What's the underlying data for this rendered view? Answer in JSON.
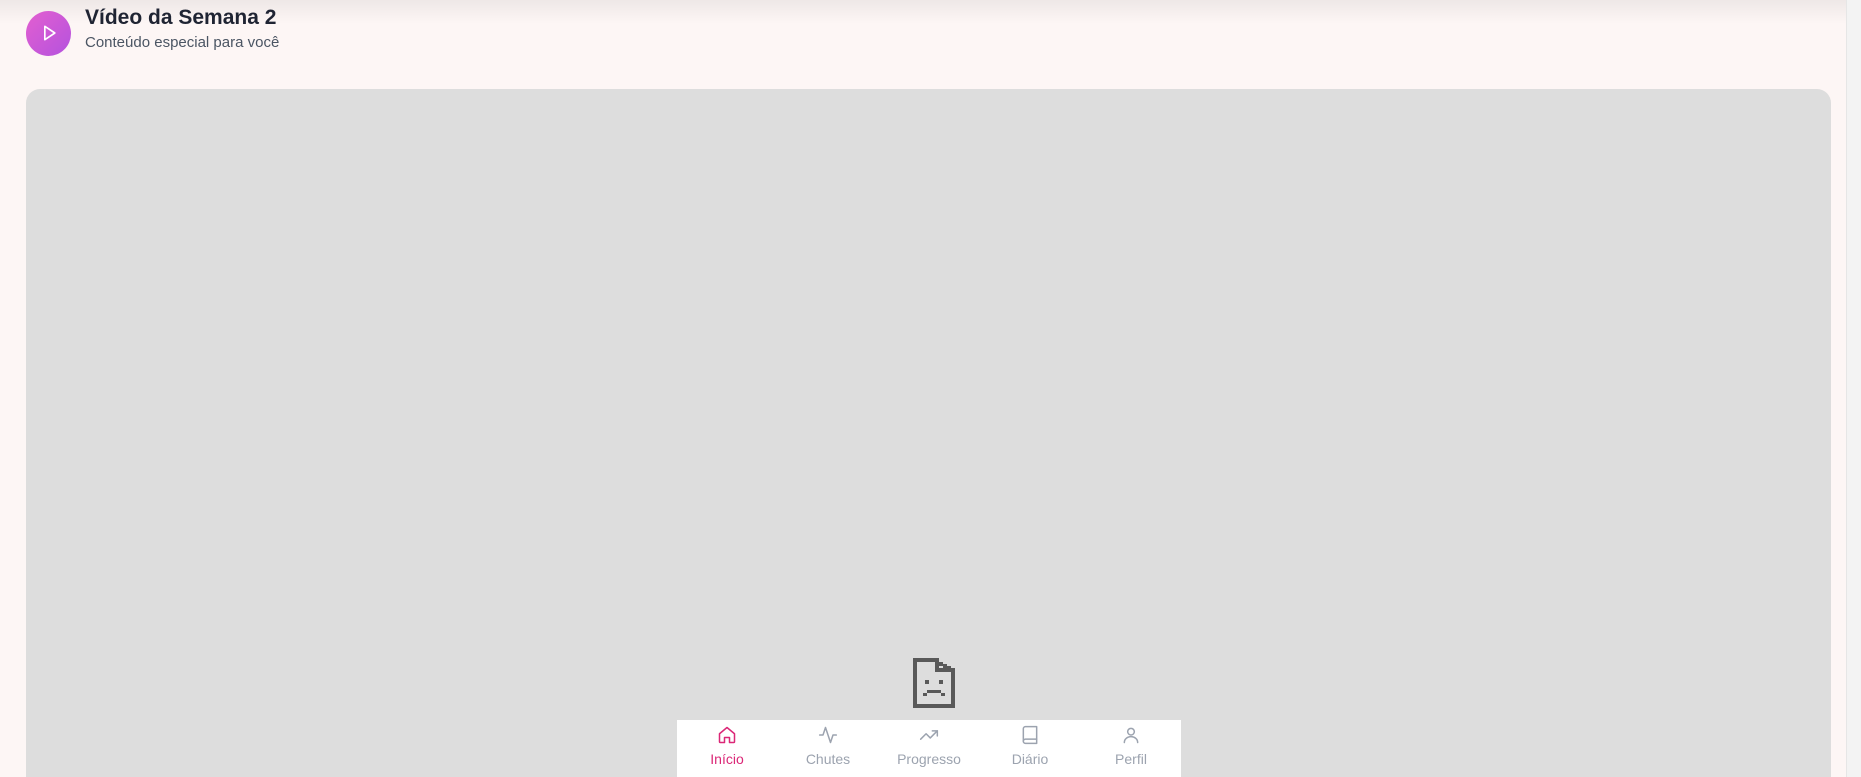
{
  "header": {
    "title": "Vídeo da Semana 2",
    "subtitle": "Conteúdo especial para você",
    "badge_icon": "play-icon",
    "badge_color": "#c95ad9"
  },
  "video": {
    "state": "broken",
    "placeholder_icon": "broken-document-icon"
  },
  "nav": {
    "active_color": "#db2777",
    "inactive_color": "#9ca3af",
    "items": [
      {
        "label": "Início",
        "icon": "home-icon",
        "active": true
      },
      {
        "label": "Chutes",
        "icon": "activity-icon",
        "active": false
      },
      {
        "label": "Progresso",
        "icon": "trending-up-icon",
        "active": false
      },
      {
        "label": "Diário",
        "icon": "book-icon",
        "active": false
      },
      {
        "label": "Perfil",
        "icon": "user-icon",
        "active": false
      }
    ]
  }
}
